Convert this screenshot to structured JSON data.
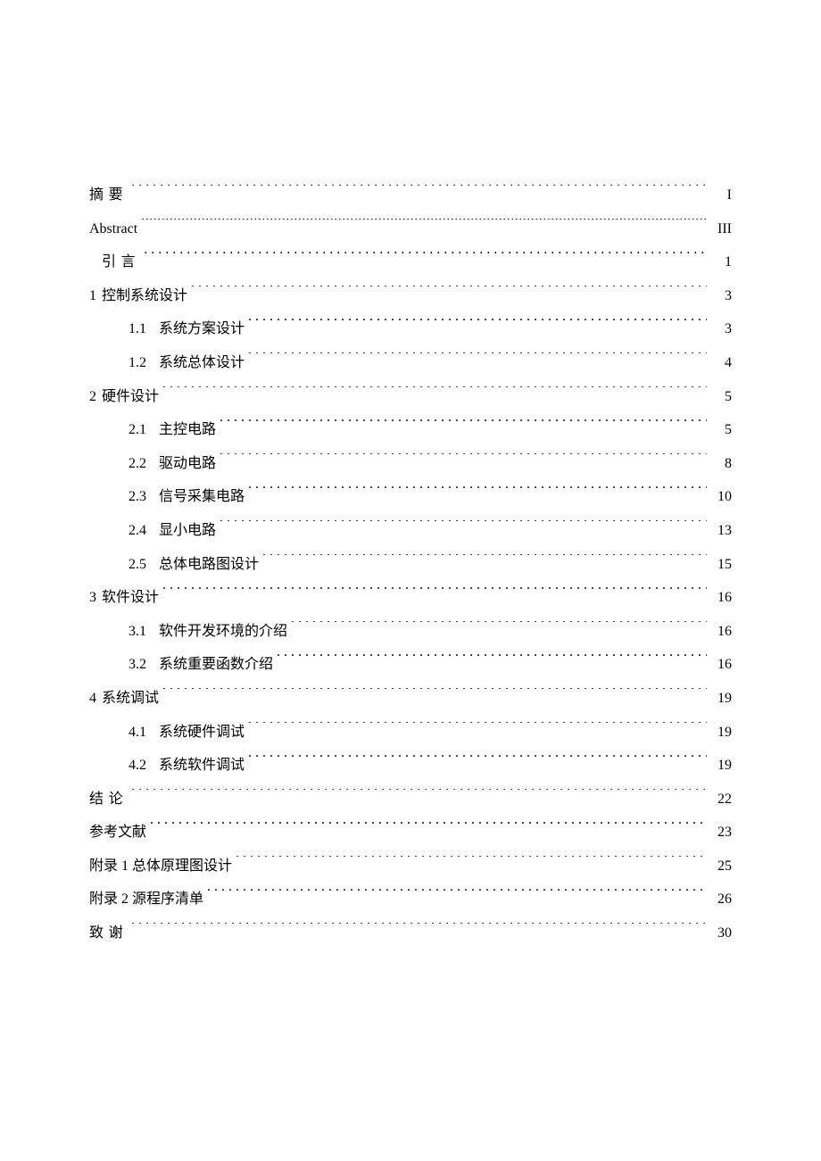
{
  "toc": {
    "entries": [
      {
        "level": "level-1",
        "num": "",
        "title": "摘要",
        "page": "I",
        "spaced": true
      },
      {
        "level": "level-1",
        "num": "",
        "title": "Abstract",
        "page": "III",
        "spaced": false,
        "fine": true
      },
      {
        "level": "level-1-indent",
        "num": "",
        "title": "引言",
        "page": "1",
        "spaced": true
      },
      {
        "level": "level-1",
        "num": "1",
        "title": "控制系统设计",
        "page": "3",
        "spaced": false
      },
      {
        "level": "level-2",
        "num": "1.1",
        "title": "系统方案设计",
        "page": "3",
        "spaced": false
      },
      {
        "level": "level-2",
        "num": "1.2",
        "title": "系统总体设计",
        "page": "4",
        "spaced": false
      },
      {
        "level": "level-1",
        "num": "2",
        "title": "硬件设计",
        "page": "5",
        "spaced": false
      },
      {
        "level": "level-2",
        "num": "2.1",
        "title": "主控电路",
        "page": "5",
        "spaced": false
      },
      {
        "level": "level-2",
        "num": "2.2",
        "title": "驱动电路",
        "page": "8",
        "spaced": false
      },
      {
        "level": "level-2",
        "num": "2.3",
        "title": "信号采集电路",
        "page": "10",
        "spaced": false
      },
      {
        "level": "level-2",
        "num": "2.4",
        "title": "显小电路",
        "page": "13",
        "spaced": false
      },
      {
        "level": "level-2",
        "num": "2.5",
        "title": "总体电路图设计",
        "page": "15",
        "spaced": false
      },
      {
        "level": "level-1",
        "num": "3",
        "title": "软件设计",
        "page": "16",
        "spaced": false
      },
      {
        "level": "level-2",
        "num": "3.1",
        "title": "软件开发环境的介绍",
        "page": "16",
        "spaced": false
      },
      {
        "level": "level-2",
        "num": "3.2",
        "title": "系统重要函数介绍",
        "page": "16",
        "spaced": false
      },
      {
        "level": "level-1",
        "num": "4",
        "title": "系统调试",
        "page": "19",
        "spaced": false
      },
      {
        "level": "level-2",
        "num": "4.1",
        "title": "系统硬件调试",
        "page": "19",
        "spaced": false
      },
      {
        "level": "level-2",
        "num": "4.2",
        "title": "系统软件调试",
        "page": "19",
        "spaced": false
      },
      {
        "level": "level-1",
        "num": "",
        "title": "结论",
        "page": "22",
        "spaced": true
      },
      {
        "level": "level-1",
        "num": "",
        "title": "参考文献",
        "page": "23",
        "spaced": false
      },
      {
        "level": "level-1",
        "num": "",
        "title": "附录 1 总体原理图设计",
        "page": "25",
        "spaced": false
      },
      {
        "level": "level-1",
        "num": "",
        "title": "附录 2 源程序清单",
        "page": "26",
        "spaced": false
      },
      {
        "level": "level-1",
        "num": "",
        "title": "致谢",
        "page": "30",
        "spaced": true
      }
    ]
  }
}
